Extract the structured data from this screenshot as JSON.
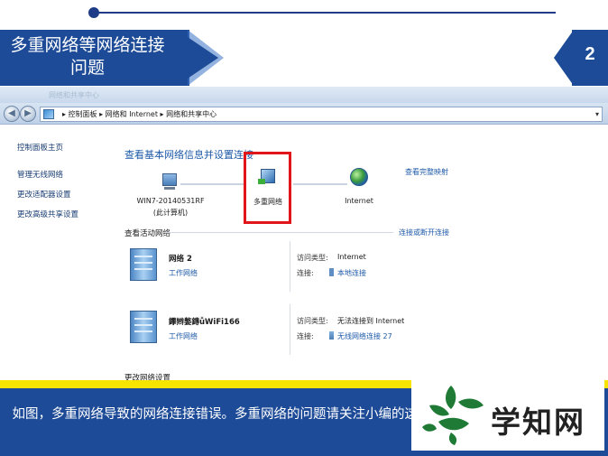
{
  "slide": {
    "title": "多重网络等网络连接问题",
    "page_number": "2",
    "caption": "如图，多重网络导致的网络连接错误。多重网络的问题请关注小编的这里就不具体讲。",
    "logo_text": "学知网",
    "colors": {
      "blue": "#1d4b97",
      "yellow": "#f7e400",
      "red_highlight": "#e0161b"
    }
  },
  "window": {
    "ghost_title": "网络和共享中心",
    "breadcrumb": "▸ 控制面板 ▸ 网络和 Internet ▸ 网络和共享中心",
    "sidebar": {
      "home": "控制面板主页",
      "items": [
        "管理无线网络",
        "更改适配器设置",
        "更改高级共享设置"
      ]
    },
    "main": {
      "heading": "查看基本网络信息并设置连接",
      "view_full_map": "查看完整映射",
      "map": {
        "computer_name": "WIN7-20140531RF",
        "computer_sub": "(此计算机)",
        "middle": "多重网络",
        "internet": "Internet"
      },
      "active_label": "查看活动网络",
      "connect_link": "连接或断开连接",
      "networks": [
        {
          "name": "网络 2",
          "type": "工作网络",
          "access_key": "访问类型:",
          "access_val": "Internet",
          "conn_key": "连接:",
          "conn_val": "本地连接"
        },
        {
          "name": "鑻辫嫳鏄ǚWiFi166",
          "type": "工作网络",
          "access_key": "访问类型:",
          "access_val": "无法连接到 Internet",
          "conn_key": "连接:",
          "conn_val": "无线网络连接 27"
        }
      ],
      "change_label": "更改网络设置"
    }
  }
}
